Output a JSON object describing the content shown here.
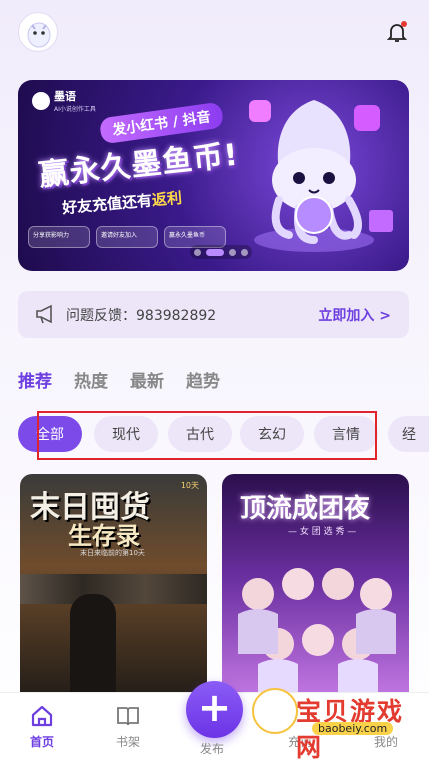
{
  "header": {
    "avatar_icon": "ghost-mascot-avatar",
    "bell_icon": "bell-icon",
    "bell_dot_color": "#e53935"
  },
  "banner": {
    "brand_name": "墨语",
    "brand_sub": "AI小说创作工具",
    "ribbon": "发小红书 / 抖音",
    "headline": "赢永久墨鱼币!",
    "subline_prefix": "好友充值还有",
    "subline_highlight": "返利",
    "chips": [
      "分享获影响力",
      "邀请好友加入",
      "赢永久墨鱼币"
    ],
    "carousel_active_index": 1,
    "carousel_count": 4
  },
  "feedback": {
    "label": "问题反馈：983982892",
    "join": "立即加入 >"
  },
  "tabs": [
    {
      "label": "推荐",
      "active": true
    },
    {
      "label": "热度",
      "active": false
    },
    {
      "label": "最新",
      "active": false
    },
    {
      "label": "趋势",
      "active": false
    }
  ],
  "categories": [
    {
      "label": "全部",
      "active": true
    },
    {
      "label": "现代",
      "active": false
    },
    {
      "label": "古代",
      "active": false
    },
    {
      "label": "玄幻",
      "active": false
    },
    {
      "label": "言情",
      "active": false
    },
    {
      "label": "经",
      "active": false
    }
  ],
  "books": [
    {
      "title_line1": "末日囤货",
      "title_line2": "生存录",
      "tagline": "末日来临前的第10天",
      "badge": "10天"
    },
    {
      "title": "顶流成团夜",
      "tagline": "— 女 团 选 秀 —"
    }
  ],
  "bottom_nav": {
    "home": "首页",
    "bookshelf": "书架",
    "publish": "发布",
    "recharge": "充值",
    "mine": "我的"
  },
  "watermark": {
    "text": "宝贝游戏网",
    "url": "baobeiy.com"
  },
  "colors": {
    "accent": "#6e3fe0",
    "highlight_box": "#e0242b"
  }
}
